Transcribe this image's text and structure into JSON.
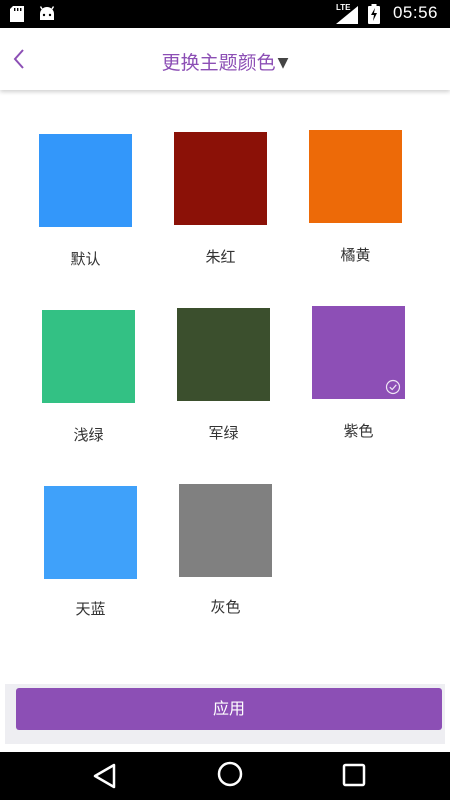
{
  "status_bar": {
    "network_type": "LTE",
    "time": "05:56",
    "icons": [
      "sd-card-icon",
      "android-icon",
      "signal-icon",
      "battery-charging-icon"
    ]
  },
  "toolbar": {
    "back_icon": "chevron-left-icon",
    "title": "更换主题颜色",
    "title_caret": "▼",
    "accent_color": "#8c4fb5"
  },
  "themes": [
    {
      "label": "默认",
      "color": "#3397fa",
      "selected": false
    },
    {
      "label": "朱红",
      "color": "#8b1107",
      "selected": false
    },
    {
      "label": "橘黄",
      "color": "#ed6a08",
      "selected": false
    },
    {
      "label": "浅绿",
      "color": "#33c184",
      "selected": false
    },
    {
      "label": "军绿",
      "color": "#3b4f2d",
      "selected": false
    },
    {
      "label": "紫色",
      "color": "#8d4fb6",
      "selected": true
    },
    {
      "label": "天蓝",
      "color": "#3fa1fa",
      "selected": false
    },
    {
      "label": "灰色",
      "color": "#808080",
      "selected": false
    }
  ],
  "apply_button": {
    "label": "应用",
    "color": "#8c4fb5"
  },
  "nav_bar": {
    "icons": [
      "nav-back-icon",
      "nav-home-icon",
      "nav-recent-icon"
    ]
  }
}
